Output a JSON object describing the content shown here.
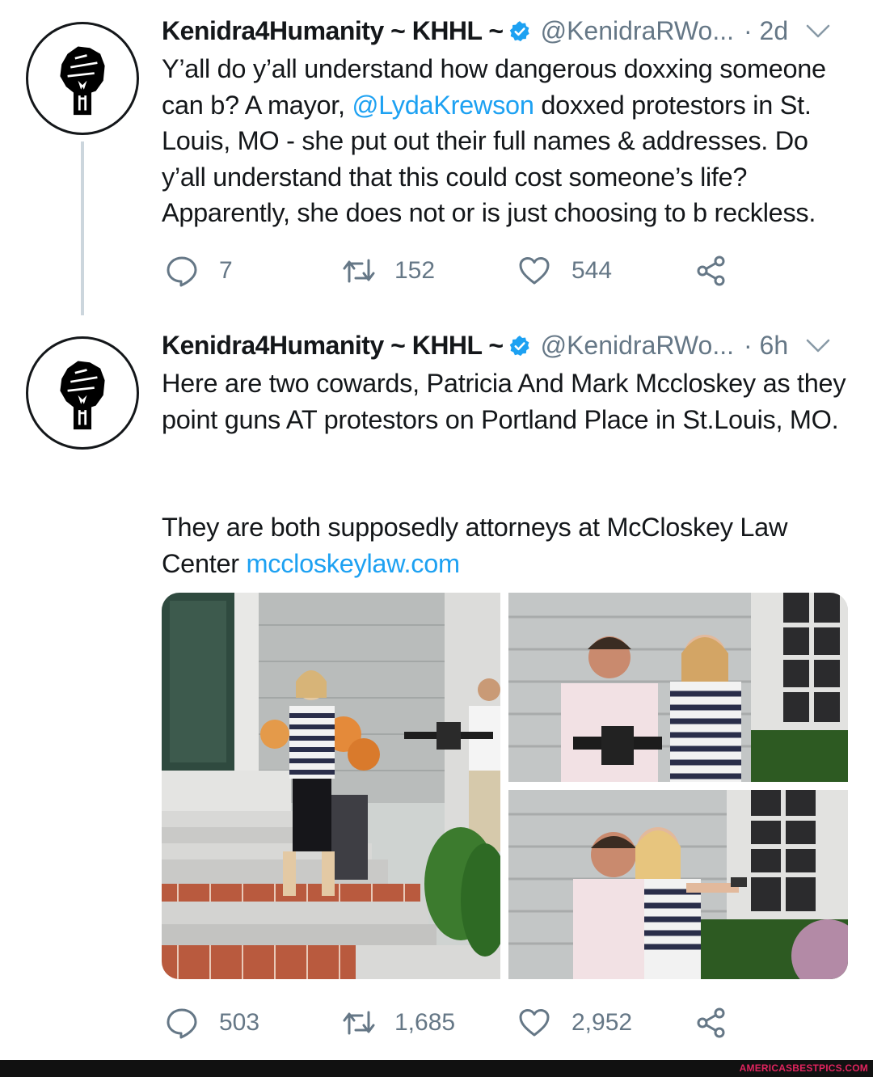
{
  "tweets": [
    {
      "display_name": "Kenidra4Humanity ~ KHHL ~",
      "handle": "@KenidraRWo...",
      "time": "· 2d",
      "avatar_icon": "raised-fist-icon",
      "text_parts": [
        "Y’all do y’all understand how dangerous doxxing someone can b? A mayor, ",
        "@LydaKrewson",
        " doxxed protestors in St. Louis, MO - she put out their full names & addresses. Do y’all understand that this could cost someone’s life? Apparently, she does not or is just choosing to b reckless."
      ],
      "replies": "7",
      "retweets": "152",
      "likes": "544"
    },
    {
      "display_name": "Kenidra4Humanity ~ KHHL ~",
      "handle": "@KenidraRWo...",
      "time": "· 6h",
      "avatar_icon": "raised-fist-icon",
      "paragraph1": "Here are two cowards, Patricia And Mark Mccloskey as they point guns AT protestors on Portland Place in St.Louis, MO.",
      "paragraph2_text": "They are both supposedly attorneys at McCloskey Law Center ",
      "paragraph2_link": "mccloskeylaw.com",
      "replies": "503",
      "retweets": "1,685",
      "likes": "2,952"
    }
  ],
  "watermark": "AMERICASBESTPICS.COM",
  "colors": {
    "link": "#1da1f2",
    "secondary_text": "#657786",
    "verified": "#1da1f2",
    "thread_line": "#ccd6dd",
    "watermark": "#e0245e"
  }
}
